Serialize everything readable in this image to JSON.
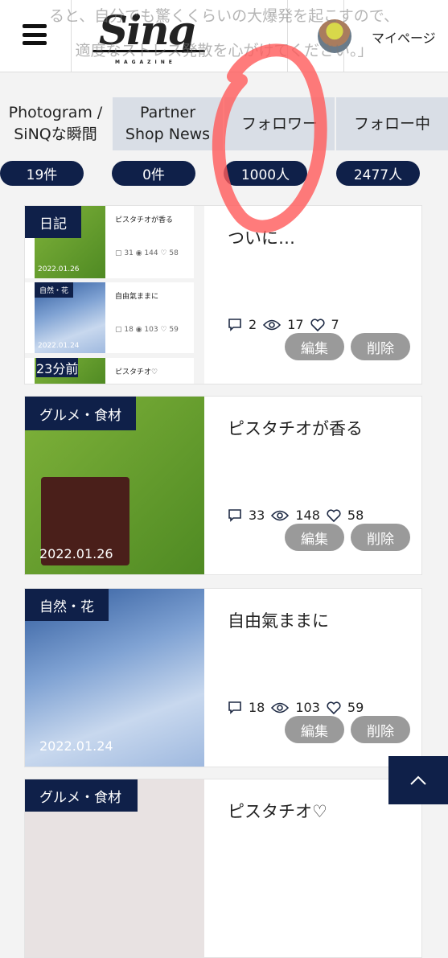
{
  "header": {
    "logo_text": "Sinq",
    "logo_sub": "MAGAZINE",
    "mypage_label": "マイページ"
  },
  "overlay_text": [
    "ると、自分でも驚くくらいの大爆発を起こすので、",
    "適度なストレス発散を心がけてください。」"
  ],
  "tabs": [
    {
      "label": "Photogram / SiNQな瞬間",
      "count": "19件",
      "active": true
    },
    {
      "label": "Partner Shop News",
      "count": "0件"
    },
    {
      "label": "フォロワー",
      "count": "1000人"
    },
    {
      "label": "フォロー中",
      "count": "2477人"
    }
  ],
  "posts": [
    {
      "category": "日記",
      "title": "ついに…",
      "comments": "2",
      "views": "17",
      "likes": "7"
    },
    {
      "category": "グルメ・食材",
      "title": "ピスタチオが香る",
      "date": "2022.01.26",
      "comments": "33",
      "views": "148",
      "likes": "58"
    },
    {
      "category": "自然・花",
      "title": "自由氣ままに",
      "date": "2022.01.24",
      "comments": "18",
      "views": "103",
      "likes": "59"
    },
    {
      "category": "グルメ・食材",
      "title": "ピスタチオ♡"
    }
  ],
  "thumb_preview": [
    {
      "title": "ピスタチオが香る",
      "date": "2022.01.26",
      "comments": "31",
      "views": "144",
      "likes": "58"
    },
    {
      "title": "自由氣ままに",
      "category": "自然・花",
      "date": "2022.01.24",
      "comments": "18",
      "views": "103",
      "likes": "59"
    },
    {
      "title": "ピスタチオ♡",
      "time": "23分前"
    }
  ],
  "actions": {
    "edit": "編集",
    "delete": "削除"
  },
  "colors": {
    "navy": "#0f2049",
    "tab_bg": "#d9dee6",
    "button_gray": "#9a9a9a",
    "annotation_red": "#ff5a5a"
  },
  "icons": {
    "comment": "speech-bubble",
    "views": "eye",
    "likes": "heart",
    "scroll_top": "chevron-up"
  }
}
